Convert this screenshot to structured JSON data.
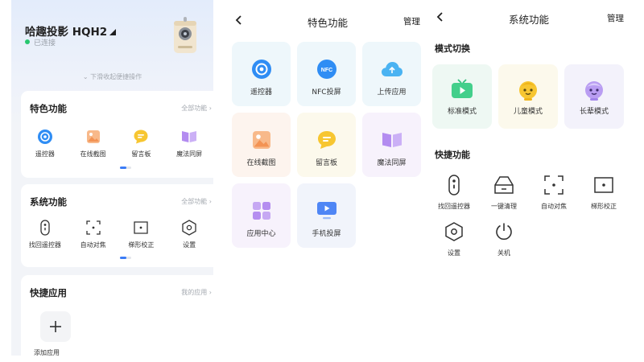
{
  "home": {
    "device_name": "哈趣投影 HQH2",
    "status": "已连接",
    "pull_hint": "下滑收起便捷操作",
    "features_card": {
      "title": "特色功能",
      "more": "全部功能",
      "items": [
        {
          "label": "遥控器",
          "icon": "remote-control-icon"
        },
        {
          "label": "在线截图",
          "icon": "screenshot-image-icon"
        },
        {
          "label": "留言板",
          "icon": "message-board-icon"
        },
        {
          "label": "魔法同屏",
          "icon": "magic-mirror-icon"
        }
      ]
    },
    "system_card": {
      "title": "系统功能",
      "more": "全部功能",
      "items": [
        {
          "label": "找回遥控器",
          "icon": "find-remote-icon"
        },
        {
          "label": "自动对焦",
          "icon": "autofocus-icon"
        },
        {
          "label": "梯形校正",
          "icon": "keystone-icon"
        },
        {
          "label": "设置",
          "icon": "settings-hexagon-icon"
        }
      ]
    },
    "apps_card": {
      "title": "快捷应用",
      "more": "我的应用",
      "add_label": "添加应用"
    }
  },
  "features_page": {
    "title": "特色功能",
    "manage": "管理",
    "tiles": [
      {
        "label": "遥控器",
        "icon": "remote-control-icon",
        "bg": "#eef7fb"
      },
      {
        "label": "NFC投屏",
        "icon": "nfc-icon",
        "icon_text": "NFC",
        "bg": "#eef7fb"
      },
      {
        "label": "上传应用",
        "icon": "cloud-upload-icon",
        "bg": "#eef7fb"
      },
      {
        "label": "在线截图",
        "icon": "screenshot-image-icon",
        "bg": "#fdf4ee"
      },
      {
        "label": "留言板",
        "icon": "message-board-icon",
        "bg": "#fcf9ec"
      },
      {
        "label": "魔法同屏",
        "icon": "magic-mirror-icon",
        "bg": "#f7f2fc"
      },
      {
        "label": "应用中心",
        "icon": "app-grid-icon",
        "bg": "#f7f2fc"
      },
      {
        "label": "手机投屏",
        "icon": "phone-cast-icon",
        "bg": "#f1f4fb"
      }
    ]
  },
  "system_page": {
    "title": "系统功能",
    "manage": "管理",
    "mode_section": "模式切换",
    "modes": [
      {
        "label": "标准模式",
        "icon": "tv-icon",
        "bg": "#eef8f3"
      },
      {
        "label": "儿童模式",
        "icon": "child-face-icon",
        "bg": "#fcf9ec"
      },
      {
        "label": "长辈模式",
        "icon": "elder-face-icon",
        "bg": "#f3f2fb"
      }
    ],
    "quick_section": "快捷功能",
    "quick": [
      {
        "label": "找回遥控器",
        "icon": "find-remote-icon"
      },
      {
        "label": "一键清理",
        "icon": "clean-icon"
      },
      {
        "label": "自动对焦",
        "icon": "autofocus-icon"
      },
      {
        "label": "梯形校正",
        "icon": "keystone-icon"
      },
      {
        "label": "设置",
        "icon": "settings-hexagon-icon"
      },
      {
        "label": "关机",
        "icon": "power-icon"
      }
    ]
  },
  "colors": {
    "accent": "#3b7cf6",
    "connected": "#28c76f"
  }
}
